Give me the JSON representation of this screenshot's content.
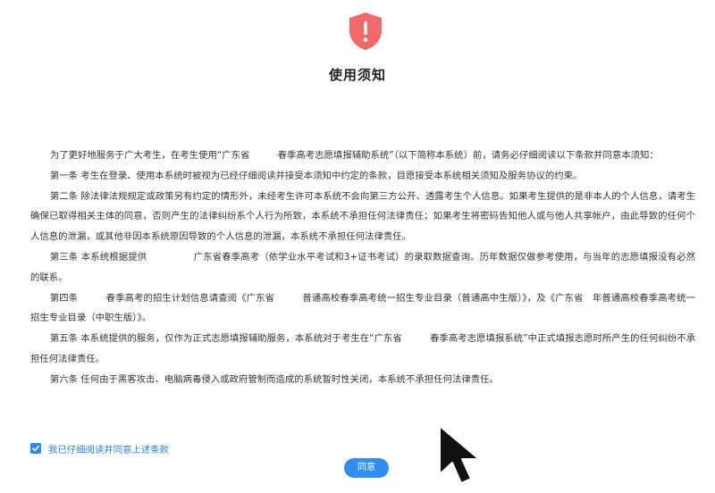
{
  "header": {
    "icon": "shield-alert-icon",
    "title": "使用须知"
  },
  "notice": {
    "paragraphs": [
      "为了更好地服务于广大考生，在考生使用“广东省　　　春季高考志愿填报辅助系统”（以下简称本系统）前，请务必仔细阅读以下条款并同意本须知：",
      "第一条 考生在登录、使用本系统时被视为已经仔细阅读并接受本须知中约定的条款，目愿接受本系统相关须知及服务协议的约束。",
      "第二条 除法律法规规定或政策另有约定的情形外，未经考生许可本系统不会向第三方公开、透露考生个人信息。如果考生提供的是非本人的个人信息，请考生确保已取得相关主体的同意，否则产生的法律纠纷系个人行为所致，本系统不承担任何法律责任；如果考生将密码告知他人或与他人共享帐户，由此导致的任何个人信息的泄漏，或其他非因本系统原因导致的个人信息的泄漏，本系统不承担任何法律责任。",
      "第三条 本系统根据提供　　　　　广东省春季高考（依学业水平考试和3+证书考试）的录取数据查询。历年数据仅做参考使用，与当年的志愿填报没有必然的联系。",
      "第四条　　　春季高考的招生计划信息请查阅《广东省　　　普通高校春季高考统一招生专业目录（普通高中生版）》，及《广东省　年普通高校春季高考统一招生专业目录（中职生版）》。",
      "第五条 本系统提供的服务，仅作为正式志愿填报辅助服务，本系统对于考生在“广东省　　　春季高考志愿填报系统”中正式填报志愿时所产生的任何纠纷不承担任何法律责任。",
      "第六条 任何由于黑客攻击、电脑病毒侵入或政府管制而造成的系统暂时性关闭，本系统不承担任何法律责任。"
    ]
  },
  "agree": {
    "checked": true,
    "label": "我已仔细阅读并同意上述条款"
  },
  "confirm": {
    "label": "同意"
  },
  "colors": {
    "shield": "#f06a6a",
    "accent": "#2f8ff0",
    "link": "#2a7fd4"
  }
}
